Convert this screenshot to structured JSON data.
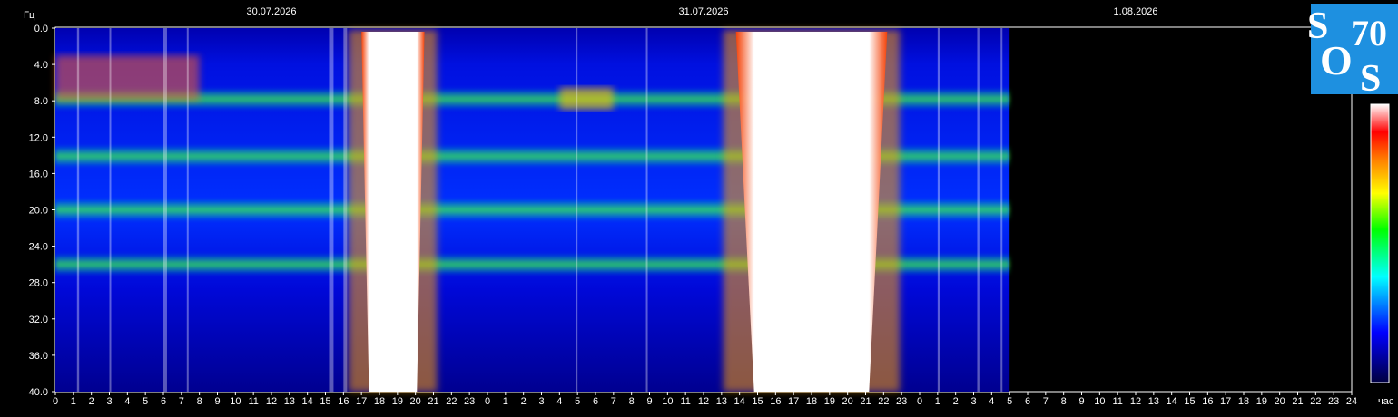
{
  "chart_data": {
    "type": "heatmap",
    "ylabel": "Гц",
    "xlabel": "час",
    "y_range": [
      0.0,
      40.0
    ],
    "y_ticks": [
      "0.0",
      "4.0",
      "8.0",
      "12.0",
      "16.0",
      "20.0",
      "24.0",
      "28.0",
      "32.0",
      "36.0",
      "40.0"
    ],
    "dates": [
      "30.07.2026",
      "31.07.2026",
      "1.08.2026"
    ],
    "x_ticks": [
      "0",
      "1",
      "2",
      "3",
      "4",
      "5",
      "6",
      "7",
      "8",
      "9",
      "10",
      "11",
      "12",
      "13",
      "14",
      "15",
      "16",
      "17",
      "18",
      "19",
      "20",
      "21",
      "22",
      "23",
      "0",
      "1",
      "2",
      "3",
      "4",
      "5",
      "6",
      "7",
      "8",
      "9",
      "10",
      "11",
      "12",
      "13",
      "14",
      "15",
      "16",
      "17",
      "18",
      "19",
      "20",
      "21",
      "22",
      "23",
      "0",
      "1",
      "2",
      "3",
      "4",
      "5",
      "6",
      "7",
      "8",
      "9",
      "10",
      "11",
      "12",
      "13",
      "14",
      "15",
      "16",
      "17",
      "18",
      "19",
      "20",
      "21",
      "22",
      "23",
      "24"
    ],
    "data_end_hours": 53.0,
    "harmonic_bands_hz": [
      7.8,
      14.1,
      20.0,
      26.0
    ],
    "saturation_intervals_hours": [
      [
        17.0,
        20.5
      ],
      [
        37.8,
        46.2
      ]
    ],
    "colorscale": [
      "#000040",
      "#0000ff",
      "#00ffff",
      "#00ff00",
      "#ffff00",
      "#ff8000",
      "#ff0000",
      "#ffffff"
    ]
  },
  "logo": {
    "letters": [
      "S",
      "70",
      "O",
      "S"
    ]
  }
}
